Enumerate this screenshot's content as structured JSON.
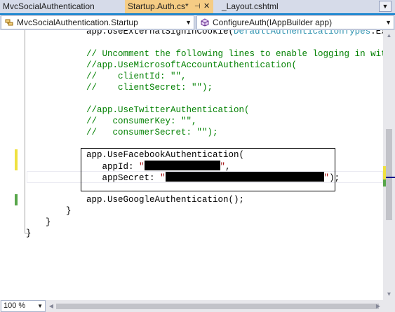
{
  "tabs": [
    {
      "label": "MvcSocialAuthentication",
      "active": false
    },
    {
      "label": "Startup.Auth.cs*",
      "active": true,
      "pin_glyph": "⊣",
      "close_glyph": "✕"
    },
    {
      "label": "_Layout.cshtml",
      "active": false
    }
  ],
  "tab_overflow_icon": "chevron-down-icon",
  "navbar": {
    "type_selector": "MvcSocialAuthentication.Startup",
    "member_selector": "ConfigureAuth(IAppBuilder app)"
  },
  "code": {
    "line1_pre": "app.UseExternalSignInCookie(",
    "line1_type": "DefaultAuthenticationTypes",
    "line1_post": ".Exter",
    "comment_ms1": "// Uncomment the following lines to enable logging in with th",
    "comment_ms2": "//app.UseMicrosoftAccountAuthentication(",
    "comment_ms3": "//    clientId: \"\",",
    "comment_ms4": "//    clientSecret: \"\");",
    "comment_tw1": "//app.UseTwitterAuthentication(",
    "comment_tw2": "//   consumerKey: \"\",",
    "comment_tw3": "//   consumerSecret: \"\");",
    "fb1": "app.UseFacebookAuthentication(",
    "fb2_pre": "   appId: ",
    "fb2_q1": "\"",
    "fb2_q2": "\"",
    "fb2_post": ",",
    "fb3_pre": "   appSecret: ",
    "fb3_q1": "\"",
    "fb3_q2": "\"",
    "fb3_post": ");",
    "google": "app.UseGoogleAuthentication();",
    "brace1": "}",
    "brace2": "}",
    "brace3": "}"
  },
  "zoom": "100 %",
  "colors": {
    "active_tab": "#f5cc84",
    "accent": "#007acc",
    "comment": "#008000",
    "string": "#a31515",
    "type": "#2b91af",
    "change_unsaved": "#efe140",
    "change_saved": "#57a64a"
  }
}
